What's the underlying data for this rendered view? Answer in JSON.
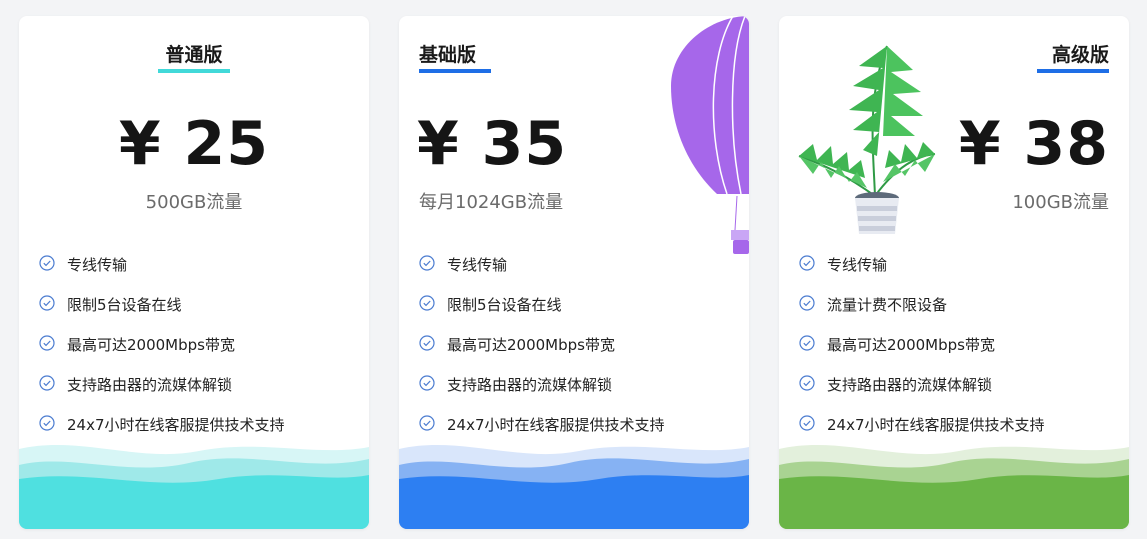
{
  "plans": [
    {
      "name": "普通版",
      "price": "¥ 25",
      "traffic": "500GB流量",
      "features": [
        "专线传输",
        "限制5台设备在线",
        "最高可达2000Mbps带宽",
        "支持路由器的流媒体解锁",
        "24x7小时在线客服提供技术支持"
      ],
      "accent": "#41d9d9"
    },
    {
      "name": "基础版",
      "price": "¥ 35",
      "traffic": "每月1024GB流量",
      "features": [
        "专线传输",
        "限制5台设备在线",
        "最高可达2000Mbps带宽",
        "支持路由器的流媒体解锁",
        "24x7小时在线客服提供技术支持"
      ],
      "accent": "#1e6ee6"
    },
    {
      "name": "高级版",
      "price": "¥ 38",
      "traffic": "100GB流量",
      "features": [
        "专线传输",
        "流量计费不限设备",
        "最高可达2000Mbps带宽",
        "支持路由器的流媒体解锁",
        "24x7小时在线客服提供技术支持"
      ],
      "accent": "#6ab547"
    }
  ],
  "icons": {
    "feature": "check-circle-icon",
    "card2_decoration": "hot-air-balloon-illustration",
    "card3_decoration": "potted-plant-illustration"
  }
}
